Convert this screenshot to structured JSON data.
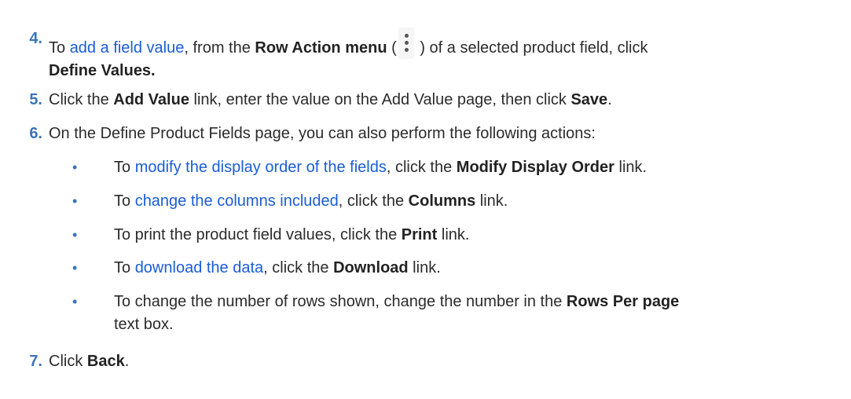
{
  "steps": [
    {
      "number": "4.",
      "prefix": "To ",
      "link": "add a field value",
      "middle": ", from the ",
      "bold1": "Row Action menu",
      "paren_open": " (",
      "paren_close": " ) of a selected product field, click",
      "bold2": "Define Values."
    },
    {
      "number": "5.",
      "prefix": "Click the ",
      "bold1": "Add Value",
      "middle": " link, enter the value on the Add Value page, then click ",
      "bold2": "Save",
      "suffix": "."
    },
    {
      "number": "6.",
      "text": "On the Define Product Fields page, you can also perform the following actions:"
    },
    {
      "number": "7.",
      "prefix": "Click ",
      "bold1": "Back",
      "suffix": "."
    }
  ],
  "bullets": [
    {
      "prefix": "To ",
      "link": "modify the display order of the fields",
      "middle": ", click the ",
      "bold": "Modify Display Order",
      "suffix": " link."
    },
    {
      "prefix": "To ",
      "link": "change the columns included",
      "middle": ", click the ",
      "bold": "Columns",
      "suffix": " link."
    },
    {
      "prefix": "To print the product field values, click the ",
      "bold": "Print",
      "suffix": " link."
    },
    {
      "prefix": "To ",
      "link": "download the data",
      "middle": ", click the ",
      "bold": "Download",
      "suffix": " link."
    },
    {
      "prefix": "To change the number of rows shown, change the number in the ",
      "bold": "Rows Per page",
      "suffix": "text box."
    }
  ],
  "bullet_glyph": "•",
  "icons": {
    "row_action": "vertical-ellipsis-icon"
  }
}
